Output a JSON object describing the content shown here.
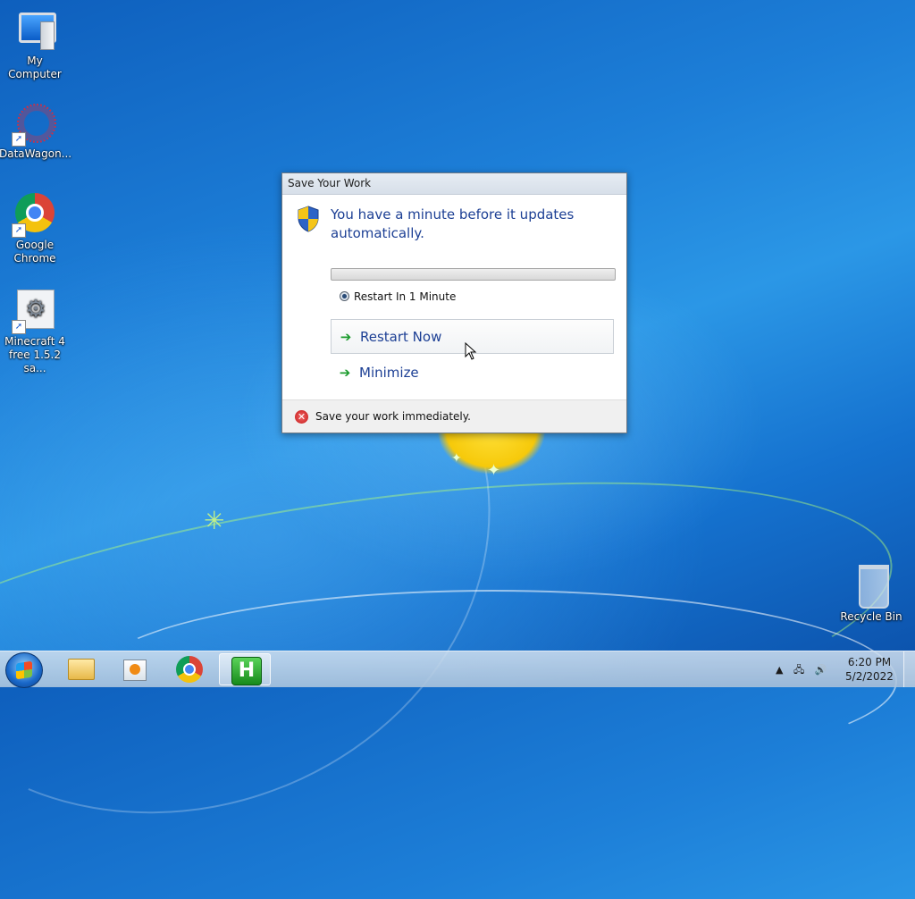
{
  "desktop": {
    "icons": [
      {
        "label": "My Computer"
      },
      {
        "label": "DataWagon..."
      },
      {
        "label": "Google Chrome"
      },
      {
        "label": "Minecraft 4 free 1.5.2 sa..."
      },
      {
        "label": "Recycle Bin"
      }
    ]
  },
  "dialog": {
    "title": "Save Your Work",
    "headline": "You have a minute before it updates automatically.",
    "progress_fraction": 0.0,
    "radio_label": "Restart In 1 Minute",
    "restart_now": "Restart Now",
    "minimize": "Minimize",
    "footer_message": "Save your work immediately."
  },
  "taskbar": {
    "apps": [
      "windows-explorer",
      "media-player",
      "google-chrome",
      "h-app"
    ],
    "clock": {
      "time": "6:20 PM",
      "date": "5/2/2022"
    }
  },
  "colors": {
    "dialog_headline": "#1c3f94",
    "desktop_blue": "#1d7fd8"
  }
}
